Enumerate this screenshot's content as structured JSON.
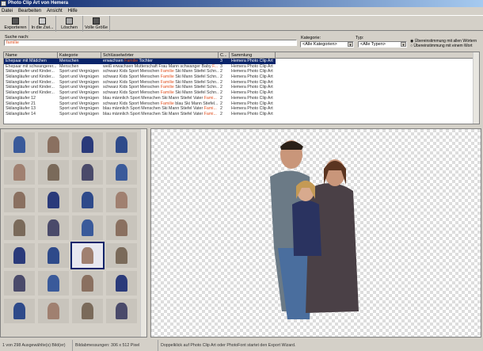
{
  "window": {
    "title": "Photo Clip Art von Hemera"
  },
  "menu": [
    "Datei",
    "Bearbeiten",
    "Ansicht",
    "Hilfe"
  ],
  "toolbar": [
    {
      "label": "Exportieren",
      "icon": "export-icon"
    },
    {
      "label": "In die Zwi...",
      "icon": "clipboard-icon"
    },
    {
      "label": "Löschen",
      "icon": "delete-icon"
    },
    {
      "label": "Volle Größe",
      "icon": "full-size-icon"
    }
  ],
  "search": {
    "label": "Suche nach:",
    "value": "familie"
  },
  "category": {
    "label": "Kategorie:",
    "value": "<Alle Kategorien>"
  },
  "type": {
    "label": "Typ:",
    "value": "<Alle Typen>"
  },
  "match": {
    "all": "Übereinstimmung mit allen Wörtern",
    "any": "Übereinstimmung mit einem Wort",
    "selected": "all"
  },
  "table": {
    "columns": [
      "Name",
      "Kategorie",
      "Schlüsselwörter",
      "C...",
      "Sammlung"
    ],
    "rows": [
      {
        "name": "Ehepaar mit Mädchen",
        "cat": "Menschen",
        "kw_a": "erwachsen ",
        "kw_h": "Familie",
        "kw_b": " Tochter",
        "c": "3",
        "coll": "Hemera Photo Clip Art",
        "selected": true
      },
      {
        "name": "Ehepaar mit schwangerer...",
        "cat": "Menschen",
        "kw_a": "weiß erwachsen Mutterschaft Frau Mann schwanger Baby ",
        "kw_h": "F...",
        "kw_b": "",
        "c": "3",
        "coll": "Hemera Photo Clip Art"
      },
      {
        "name": "Skilangläufer und Kinder...",
        "cat": "Sport und Vergnügen",
        "kw_a": "schwarz Kids Sport Menschen ",
        "kw_h": "Familie",
        "kw_b": " Ski Mann Stiefel Schn...",
        "c": "2",
        "coll": "Hemera Photo Clip Art"
      },
      {
        "name": "Skilangläufer und Kinder...",
        "cat": "Sport und Vergnügen",
        "kw_a": "schwarz Kids Sport Menschen ",
        "kw_h": "Familie",
        "kw_b": " Ski Mann Stiefel Schn...",
        "c": "2",
        "coll": "Hemera Photo Clip Art"
      },
      {
        "name": "Skilangläufer und Kinder...",
        "cat": "Sport und Vergnügen",
        "kw_a": "schwarz Kids Sport Menschen ",
        "kw_h": "Familie",
        "kw_b": " Ski Mann Stiefel Schn...",
        "c": "2",
        "coll": "Hemera Photo Clip Art"
      },
      {
        "name": "Skilangläufer und Kinder...",
        "cat": "Sport und Vergnügen",
        "kw_a": "schwarz Kids Sport Menschen ",
        "kw_h": "Familie",
        "kw_b": " Ski Mann Stiefel Schn...",
        "c": "2",
        "coll": "Hemera Photo Clip Art"
      },
      {
        "name": "Skilangläufer und Kinder...",
        "cat": "Sport und Vergnügen",
        "kw_a": "schwarz Kids Sport Menschen ",
        "kw_h": "Familie",
        "kw_b": " Ski Mann Stiefel Schn...",
        "c": "2",
        "coll": "Hemera Photo Clip Art"
      },
      {
        "name": "Skilangläufer 12",
        "cat": "Sport und Vergnügen",
        "kw_a": "blau männlich Sport Menschen Ski Mann Stiefel Vater ",
        "kw_h": "Fami...",
        "kw_b": "",
        "c": "2",
        "coll": "Hemera Photo Clip Art"
      },
      {
        "name": "Skilangläufer 21",
        "cat": "Sport und Vergnügen",
        "kw_a": "schwarz Kids Sport Menschen ",
        "kw_h": "Familie",
        "kw_b": " blau Ski Mann Stiefel...",
        "c": "2",
        "coll": "Hemera Photo Clip Art"
      },
      {
        "name": "Skilangläufer 13",
        "cat": "Sport und Vergnügen",
        "kw_a": "blau männlich Sport Menschen Ski Mann Stiefel Vater ",
        "kw_h": "Fami...",
        "kw_b": "",
        "c": "2",
        "coll": "Hemera Photo Clip Art"
      },
      {
        "name": "Skilangläufer 14",
        "cat": "Sport und Vergnügen",
        "kw_a": "blau männlich Sport Menschen Ski Mann Stiefel Vater ",
        "kw_h": "Fami...",
        "kw_b": "",
        "c": "2",
        "coll": "Hemera Photo Clip Art"
      }
    ]
  },
  "status": {
    "selection": "1 von 298 Ausgewählte(s) Bild(er)",
    "dimensions": "Bildabmessungen: 306 x 512 Pixel",
    "hint": "Doppelklick auf Photo Clip Art oder PhotoFont startet den Export Wizard."
  },
  "colors": {
    "highlight": "#e05020",
    "selection": "#0a246a"
  }
}
